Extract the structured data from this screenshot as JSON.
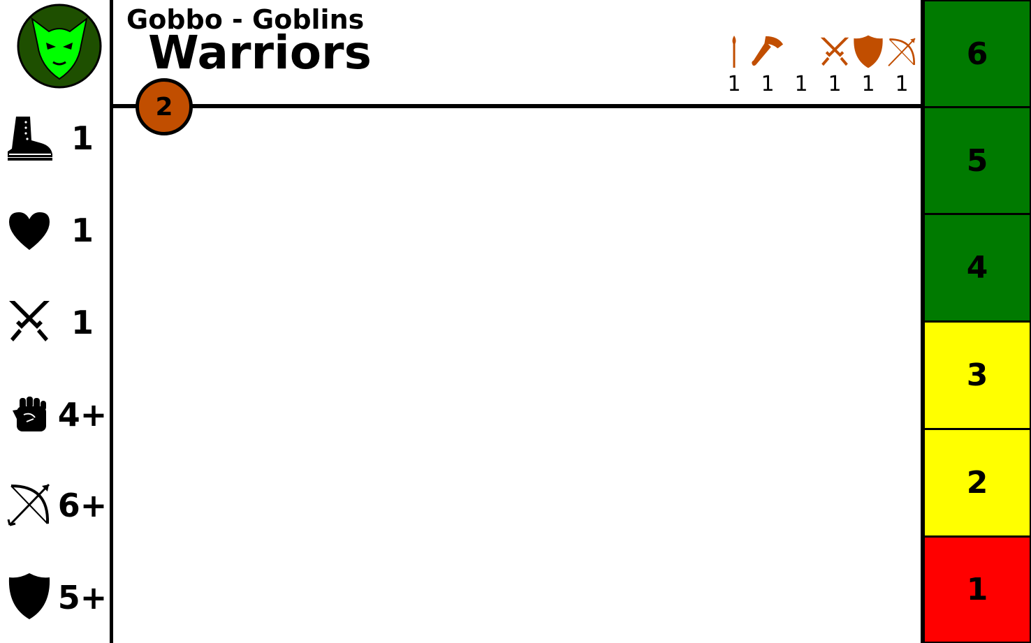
{
  "header": {
    "faction": "Gobbo - Goblins",
    "unit_name": "Warriors",
    "cost": "2"
  },
  "emblem": {
    "icon": "goblin-head-icon",
    "bg": "#1e4f00",
    "face": "#00ff00"
  },
  "stats": [
    {
      "icon": "boot-icon",
      "label": "Move",
      "value": "1"
    },
    {
      "icon": "heart-icon",
      "label": "Wounds",
      "value": "1"
    },
    {
      "icon": "crossed-swords-icon",
      "label": "Attacks",
      "value": "1"
    },
    {
      "icon": "fist-icon",
      "label": "Melee",
      "value": "4+"
    },
    {
      "icon": "bow-icon",
      "label": "Ranged",
      "value": "6+"
    },
    {
      "icon": "shield-icon",
      "label": "Save",
      "value": "5+"
    }
  ],
  "weapons": [
    {
      "icon": "spear-icon",
      "count": "1"
    },
    {
      "icon": "axe-icon",
      "count": "1"
    },
    {
      "icon": "blank",
      "count": "1"
    },
    {
      "icon": "crossed-swords-icon",
      "count": "1"
    },
    {
      "icon": "shield-icon",
      "count": "1"
    },
    {
      "icon": "bow-icon",
      "count": "1"
    }
  ],
  "weapon_color": "#c14e00",
  "damage_track": [
    {
      "value": "6",
      "color": "#007a00"
    },
    {
      "value": "5",
      "color": "#007a00"
    },
    {
      "value": "4",
      "color": "#007a00"
    },
    {
      "value": "3",
      "color": "#ffff00"
    },
    {
      "value": "2",
      "color": "#ffff00"
    },
    {
      "value": "1",
      "color": "#ff0000"
    }
  ]
}
